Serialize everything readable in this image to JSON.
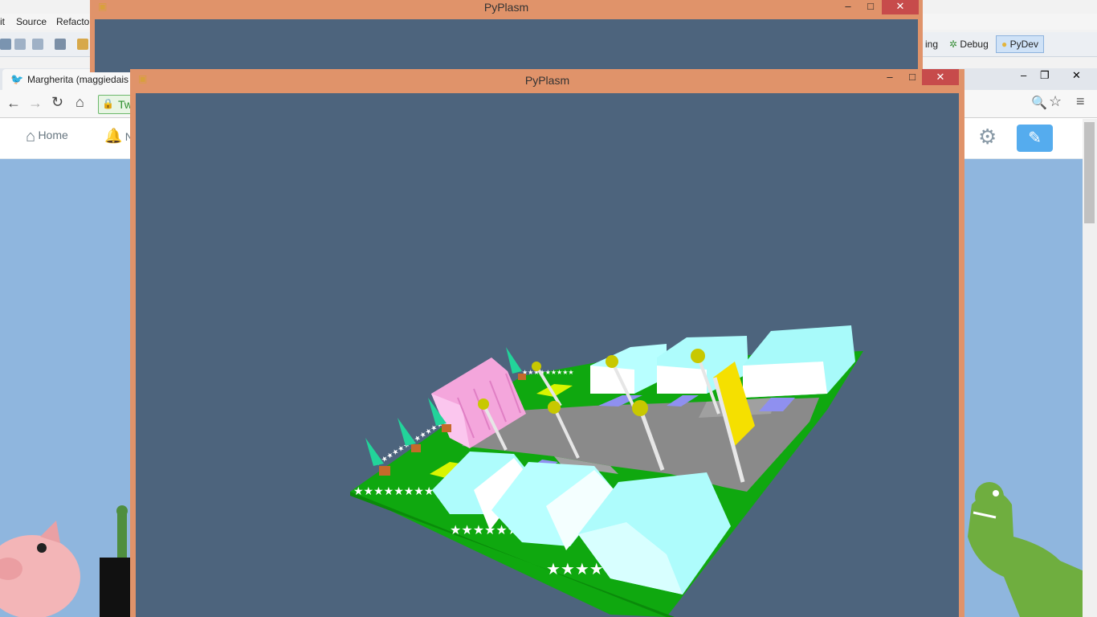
{
  "eclipse": {
    "menu": [
      "it",
      "Source",
      "Refacto"
    ],
    "perspectives": [
      "ing",
      "Debug",
      "PyDev"
    ]
  },
  "chrome": {
    "tab_title": "Margherita (maggiedais",
    "omnibox_prefix": "Tw"
  },
  "twitter": {
    "home_label": "Home",
    "notif_initial": "N"
  },
  "pyplasm_back": {
    "title": "PyPlasm",
    "minimize": "–",
    "maximize": "□",
    "close": "✕"
  },
  "pyplasm_front": {
    "title": "PyPlasm",
    "minimize": "–",
    "maximize": "□",
    "close": "✕"
  },
  "chrome_win_controls": {
    "minimize": "–",
    "maximize": "❐",
    "close": "✕"
  },
  "colors": {
    "frame": "#e0936a",
    "viewport": "#4d647d",
    "grass": "#0fa80f",
    "road": "#8a8a8a",
    "building": "#aefcfc",
    "pink_building": "#f4a6dc",
    "flag": "#f5e000",
    "lamp": "#c8c800",
    "tree": "#22d49a",
    "twitter_blue": "#55acee"
  }
}
